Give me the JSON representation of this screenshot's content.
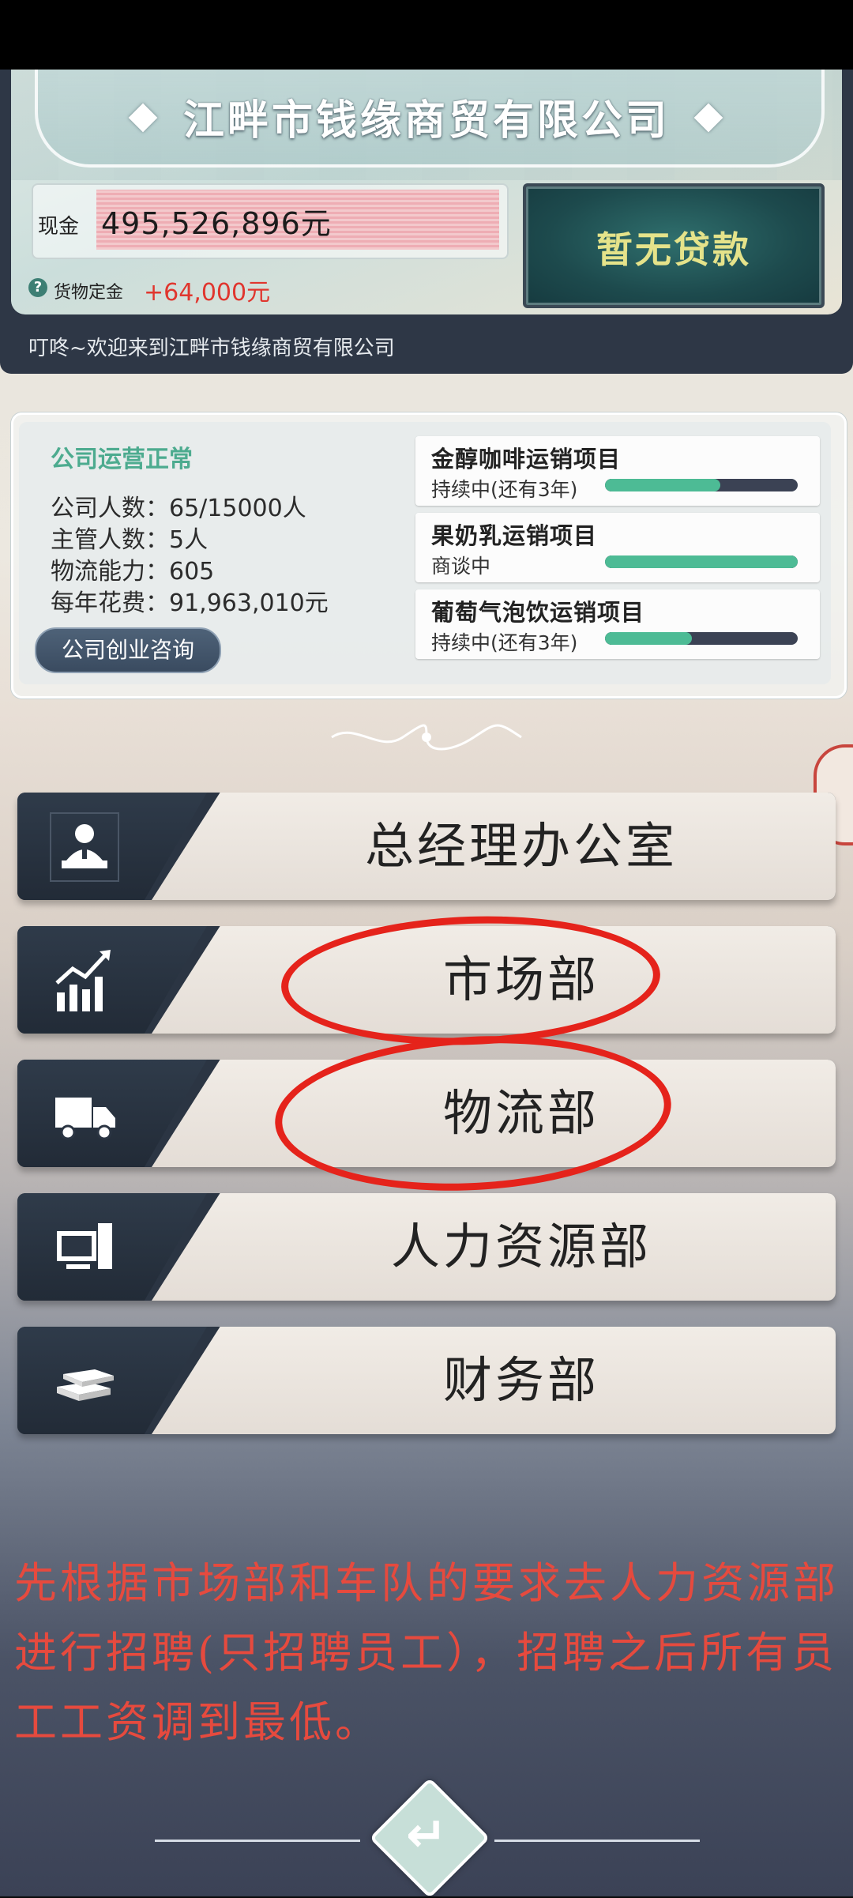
{
  "company": {
    "title": "江畔市钱缘商贸有限公司"
  },
  "finance": {
    "cash_label": "现金",
    "cash_value": "495,526,896元",
    "deposit_label": "货物定金",
    "deposit_value": "+64,000元",
    "loan_label": "暂无贷款"
  },
  "welcome_message": "叮咚~欢迎来到江畔市钱缘商贸有限公司",
  "status": {
    "title": "公司运营正常",
    "stats": [
      "公司人数：65/15000人",
      "主管人数：5人",
      "物流能力：605",
      "每年花费：91,963,010元"
    ],
    "consult_label": "公司创业咨询"
  },
  "projects": [
    {
      "name": "金醇咖啡运销项目",
      "status": "持续中(还有3年)",
      "progress": 0.6
    },
    {
      "name": "果奶乳运销项目",
      "status": "商谈中",
      "progress": 1.0
    },
    {
      "name": "葡萄气泡饮运销项目",
      "status": "持续中(还有3年)",
      "progress": 0.45
    }
  ],
  "departments": [
    {
      "label": "总经理办公室",
      "icon": "manager-icon"
    },
    {
      "label": "市场部",
      "icon": "chart-icon"
    },
    {
      "label": "物流部",
      "icon": "truck-icon"
    },
    {
      "label": "人力资源部",
      "icon": "computer-icon"
    },
    {
      "label": "财务部",
      "icon": "money-icon"
    }
  ],
  "instruction": "先根据市场部和车队的要求去人力资源部进行招聘(只招聘员工），招聘之后所有员工工资调到最低。",
  "colors": {
    "accent_green": "#4dbb95",
    "annotation_red": "#e5231b",
    "deposit_red": "#e0362e",
    "loan_text": "#e5e38a"
  }
}
